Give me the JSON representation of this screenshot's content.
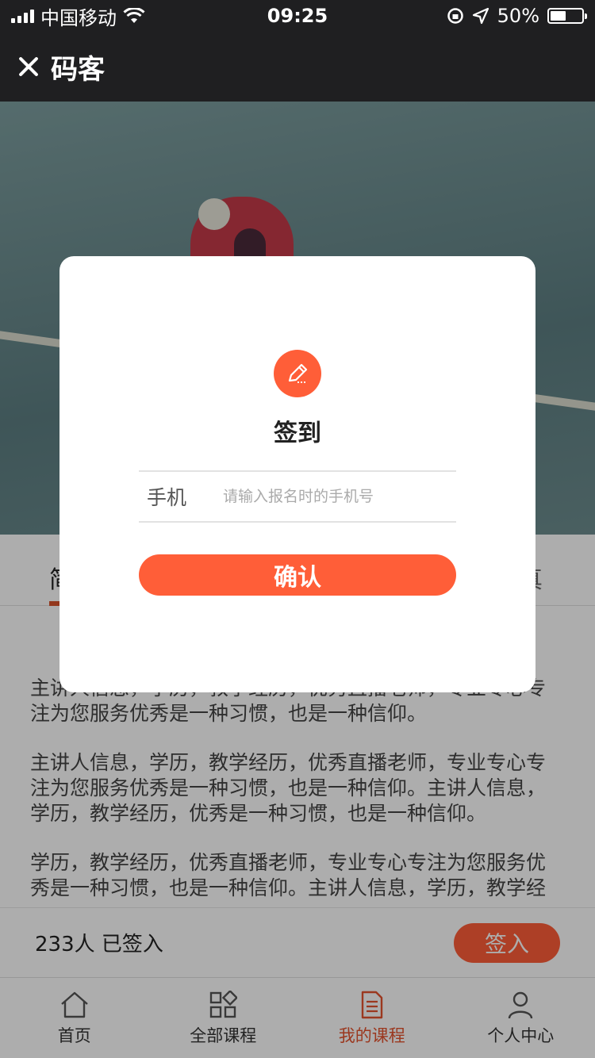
{
  "status_bar": {
    "carrier": "中国移动",
    "time": "09:25",
    "battery": "50%",
    "battery_level": 0.5
  },
  "nav": {
    "title": "码客"
  },
  "tabs": {
    "left_label": "简",
    "right_label": "真"
  },
  "content": {
    "paragraphs": [
      "主讲人信息，学历，教学经历，优秀直播老师，专业专心专注为您服务优秀是一种习惯，也是一种信仰。",
      "主讲人信息，学历，教学经历，优秀直播老师，专业专心专注为您服务优秀是一种习惯，也是一种信仰。主讲人信息，学历，教学经历，优秀是一种习惯，也是一种信仰。",
      "学历，教学经历，优秀直播老师，专业专心专注为您服务优秀是一种习惯，也是一种信仰。主讲人信息，学历，教学经"
    ]
  },
  "signbar": {
    "count_text": "233人 已签入",
    "button_label": "签入"
  },
  "tabbar": {
    "items": [
      {
        "label": "首页",
        "icon": "home-icon",
        "active": false
      },
      {
        "label": "全部课程",
        "icon": "grid-icon",
        "active": false
      },
      {
        "label": "我的课程",
        "icon": "document-icon",
        "active": true
      },
      {
        "label": "个人中心",
        "icon": "user-icon",
        "active": false
      }
    ]
  },
  "modal": {
    "icon": "pencil-icon",
    "title": "签到",
    "field_label": "手机",
    "field_placeholder": "请输入报名时的手机号",
    "field_value": "",
    "confirm_label": "确认"
  },
  "colors": {
    "accent": "#ff5e38",
    "active_tab": "#e5532f",
    "dark_bar": "#1f1f21"
  }
}
